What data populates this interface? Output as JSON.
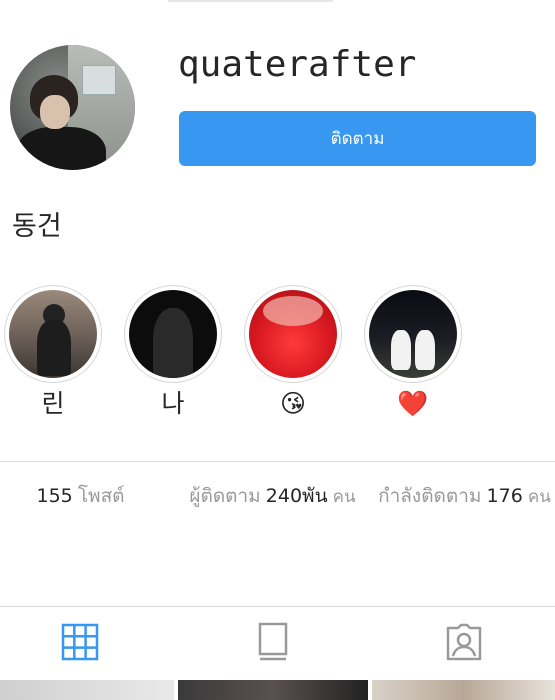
{
  "profile": {
    "username": "quaterafter",
    "follow_label": "ติดตาม",
    "display_name": "동건"
  },
  "highlights": [
    {
      "label": "린"
    },
    {
      "label": "나"
    },
    {
      "label": "😘"
    },
    {
      "label": "❤️"
    }
  ],
  "stats": {
    "posts": {
      "value": "155",
      "label": "โพสต์"
    },
    "followers": {
      "label": "ผู้ติดตาม",
      "value": "240พัน",
      "unit": "คน"
    },
    "following": {
      "label": "กำลังติดตาม",
      "value": "176",
      "unit": "คน"
    }
  },
  "tabs": [
    {
      "icon": "grid-icon",
      "active": true
    },
    {
      "icon": "feed-list-icon",
      "active": false
    },
    {
      "icon": "tagged-person-icon",
      "active": false
    }
  ],
  "colors": {
    "accent": "#3897f0",
    "text": "#262626",
    "muted": "#999999",
    "divider": "#dbdbdb"
  }
}
